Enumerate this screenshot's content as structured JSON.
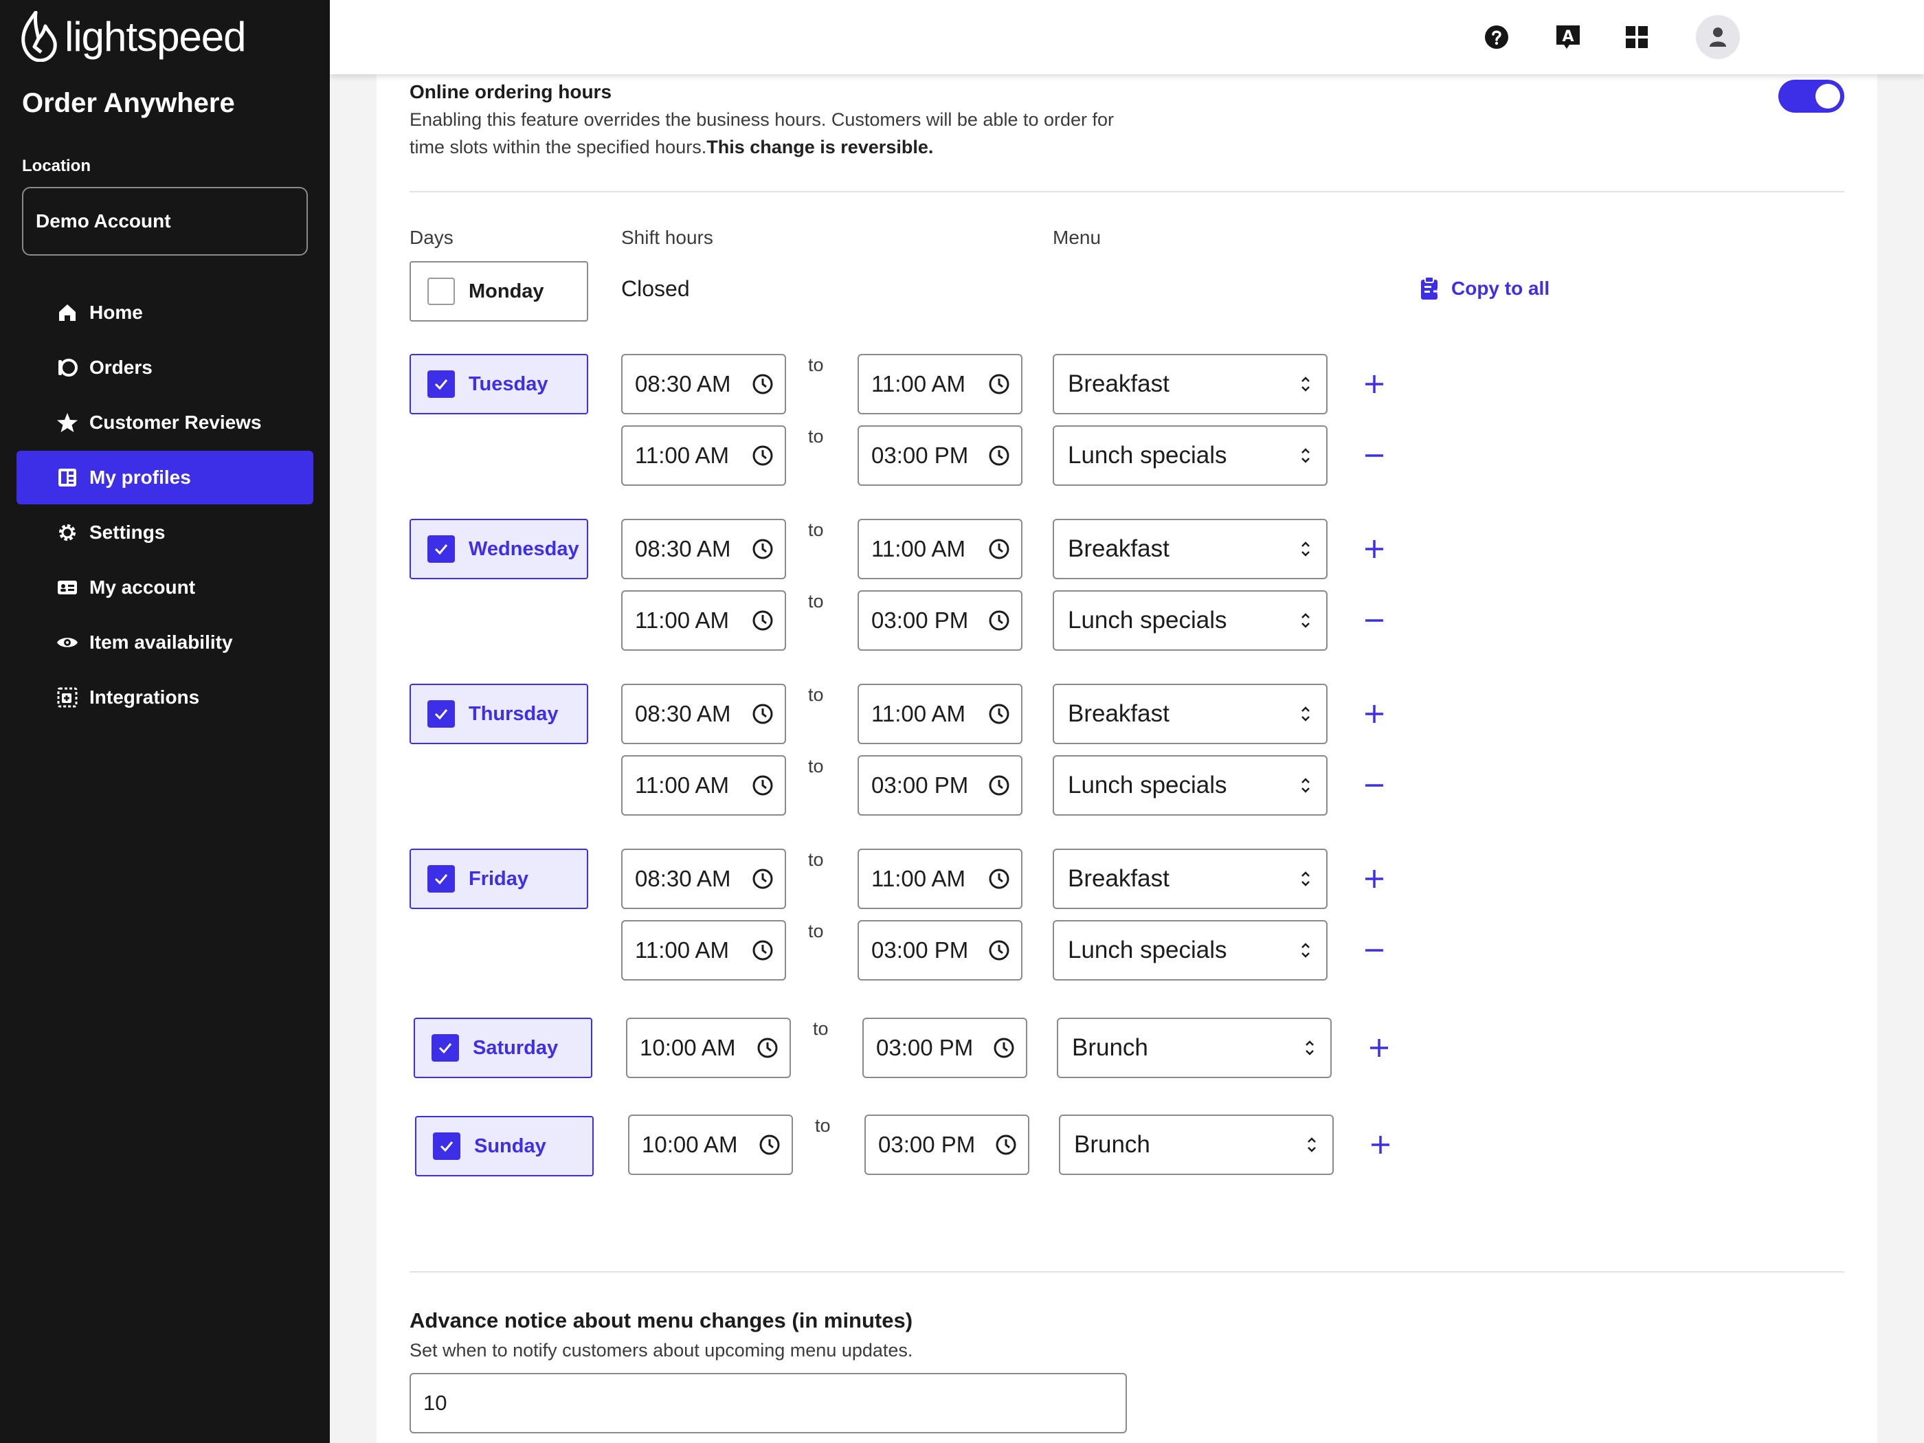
{
  "brand": {
    "logo_text": "lightspeed",
    "app_title": "Order Anywhere",
    "accent_color": "#3d2ee8"
  },
  "location": {
    "label": "Location",
    "value": "Demo Account"
  },
  "nav": [
    {
      "label": "Home",
      "icon": "home-icon"
    },
    {
      "label": "Orders",
      "icon": "orders-icon"
    },
    {
      "label": "Customer Reviews",
      "icon": "star-icon"
    },
    {
      "label": "My profiles",
      "icon": "profiles-icon",
      "active": true
    },
    {
      "label": "Settings",
      "icon": "gear-icon"
    },
    {
      "label": "My account",
      "icon": "id-card-icon"
    },
    {
      "label": "Item availability",
      "icon": "eye-icon"
    },
    {
      "label": "Integrations",
      "icon": "integrations-icon"
    }
  ],
  "topbar": {
    "icons": [
      "help-icon",
      "translate-icon",
      "apps-grid-icon",
      "user-avatar-icon"
    ]
  },
  "online_hours": {
    "title": "Online ordering hours",
    "description": "Enabling this feature overrides the business hours. Customers will be able to order for time slots within the specified hours.",
    "description_bold": "This change is reversible.",
    "enabled": true
  },
  "columns": {
    "days": "Days",
    "shift_hours": "Shift hours",
    "menu": "Menu"
  },
  "connector": "to",
  "closed_label": "Closed",
  "copy_to_all": "Copy to all",
  "days": {
    "monday": {
      "label": "Monday",
      "checked": false
    },
    "tuesday": {
      "label": "Tuesday",
      "checked": true,
      "shifts": [
        {
          "from": "08:30 AM",
          "to": "11:00 AM",
          "menu": "Breakfast"
        },
        {
          "from": "11:00 AM",
          "to": "03:00 PM",
          "menu": "Lunch specials"
        }
      ]
    },
    "wednesday": {
      "label": "Wednesday",
      "checked": true,
      "shifts": [
        {
          "from": "08:30 AM",
          "to": "11:00 AM",
          "menu": "Breakfast"
        },
        {
          "from": "11:00 AM",
          "to": "03:00 PM",
          "menu": "Lunch specials"
        }
      ]
    },
    "thursday": {
      "label": "Thursday",
      "checked": true,
      "shifts": [
        {
          "from": "08:30 AM",
          "to": "11:00 AM",
          "menu": "Breakfast"
        },
        {
          "from": "11:00 AM",
          "to": "03:00 PM",
          "menu": "Lunch specials"
        }
      ]
    },
    "friday": {
      "label": "Friday",
      "checked": true,
      "shifts": [
        {
          "from": "08:30 AM",
          "to": "11:00 AM",
          "menu": "Breakfast"
        },
        {
          "from": "11:00 AM",
          "to": "03:00 PM",
          "menu": "Lunch specials"
        }
      ]
    },
    "saturday": {
      "label": "Saturday",
      "checked": true,
      "shifts": [
        {
          "from": "10:00 AM",
          "to": "03:00 PM",
          "menu": "Brunch"
        }
      ]
    },
    "sunday": {
      "label": "Sunday",
      "checked": true,
      "shifts": [
        {
          "from": "10:00 AM",
          "to": "03:00 PM",
          "menu": "Brunch"
        }
      ]
    }
  },
  "advance_notice": {
    "title": "Advance notice about menu changes (in minutes)",
    "description": "Set when to notify customers about upcoming menu updates.",
    "value": "10"
  }
}
